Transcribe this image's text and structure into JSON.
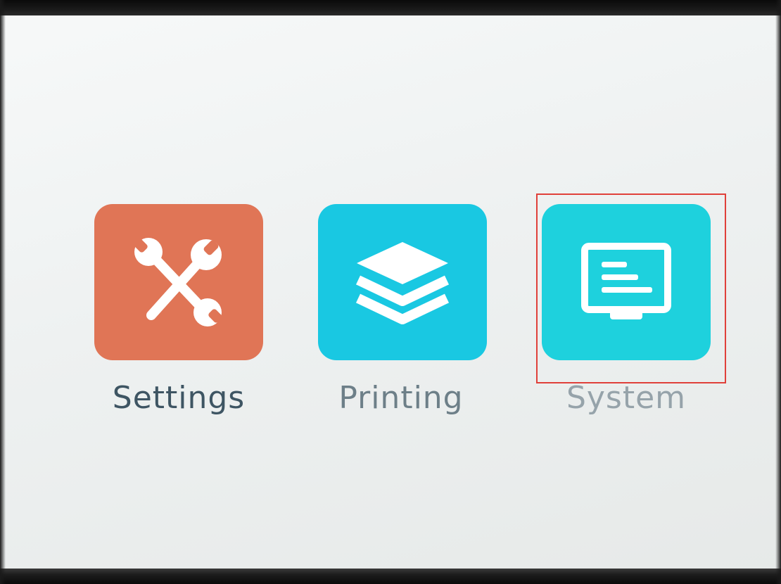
{
  "menu": {
    "items": [
      {
        "id": "settings",
        "label": "Settings",
        "icon": "wrench-screwdriver-icon",
        "tile_color": "#e07556",
        "label_color": "#3e5563"
      },
      {
        "id": "printing",
        "label": "Printing",
        "icon": "layers-icon",
        "tile_color": "#19c8e2",
        "label_color": "#6d7f88"
      },
      {
        "id": "system",
        "label": "System",
        "icon": "monitor-icon",
        "tile_color": "#1ed1dd",
        "label_color": "#96a3aa"
      }
    ],
    "selected": "system",
    "highlight_color": "#e0403a"
  },
  "colors": {
    "screen_background": "#eef1f1",
    "icon_glyph": "#ffffff",
    "bezel": "#111111"
  }
}
